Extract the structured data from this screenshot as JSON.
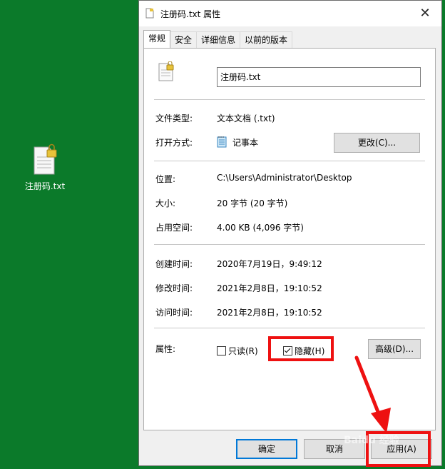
{
  "desktop": {
    "icon_label": "注册码.txt"
  },
  "dialog": {
    "title": "注册码.txt 属性",
    "close_glyph": "✕",
    "tabs": [
      {
        "label": "常规",
        "active": true
      },
      {
        "label": "安全",
        "active": false
      },
      {
        "label": "详细信息",
        "active": false
      },
      {
        "label": "以前的版本",
        "active": false
      }
    ],
    "filename": "注册码.txt",
    "file_type": {
      "label": "文件类型:",
      "value": "文本文档 (.txt)"
    },
    "open_with": {
      "label": "打开方式:",
      "app": "记事本",
      "change_button": "更改(C)..."
    },
    "location": {
      "label": "位置:",
      "value": "C:\\Users\\Administrator\\Desktop"
    },
    "size": {
      "label": "大小:",
      "value": "20 字节 (20 字节)"
    },
    "size_on_disk": {
      "label": "占用空间:",
      "value": "4.00 KB (4,096 字节)"
    },
    "created": {
      "label": "创建时间:",
      "value": "2020年7月19日，9:49:12"
    },
    "modified": {
      "label": "修改时间:",
      "value": "2021年2月8日，19:10:52"
    },
    "accessed": {
      "label": "访问时间:",
      "value": "2021年2月8日，19:10:52"
    },
    "attributes": {
      "label": "属性:",
      "readonly": {
        "label": "只读(R)",
        "checked": false
      },
      "hidden": {
        "label": "隐藏(H)",
        "checked": true
      },
      "advanced_button": "高级(D)..."
    },
    "buttons": {
      "ok": "确定",
      "cancel": "取消",
      "apply": "应用(A)"
    }
  },
  "watermark": "Baidu 经验",
  "colors": {
    "desktop": "#0b7a2a",
    "highlight": "#e11111"
  }
}
